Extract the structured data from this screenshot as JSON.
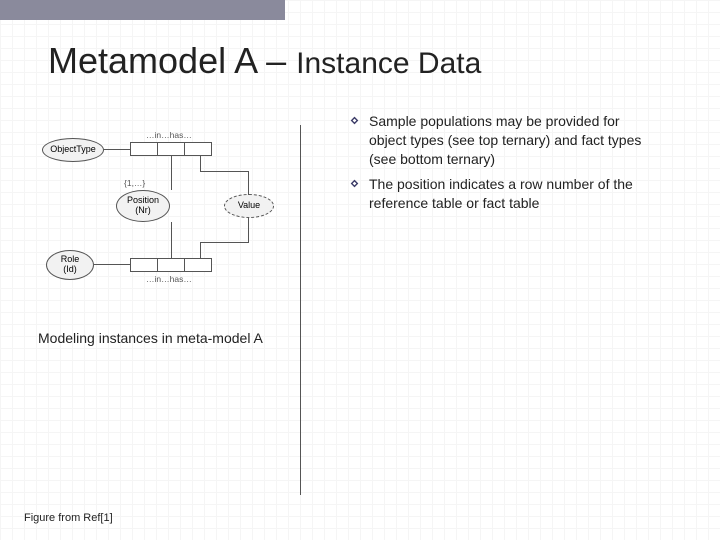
{
  "title_main": "Metamodel A – ",
  "title_sub": "Instance Data",
  "bullets": [
    "Sample populations may be provided for object types (see top ternary) and fact types (see bottom ternary)",
    "The position indicates a row number of the reference table or fact table"
  ],
  "caption": "Modeling instances in meta-model A",
  "footer": "Figure from Ref[1]",
  "diagram": {
    "object_type": "ObjectType",
    "position": "Position",
    "position_sub": "(Nr)",
    "role": "Role",
    "role_sub": "(Id)",
    "value": "Value",
    "in_has_top": "…in…has…",
    "in_has_bottom": "…in…has…",
    "constraint": "{1,…}"
  }
}
